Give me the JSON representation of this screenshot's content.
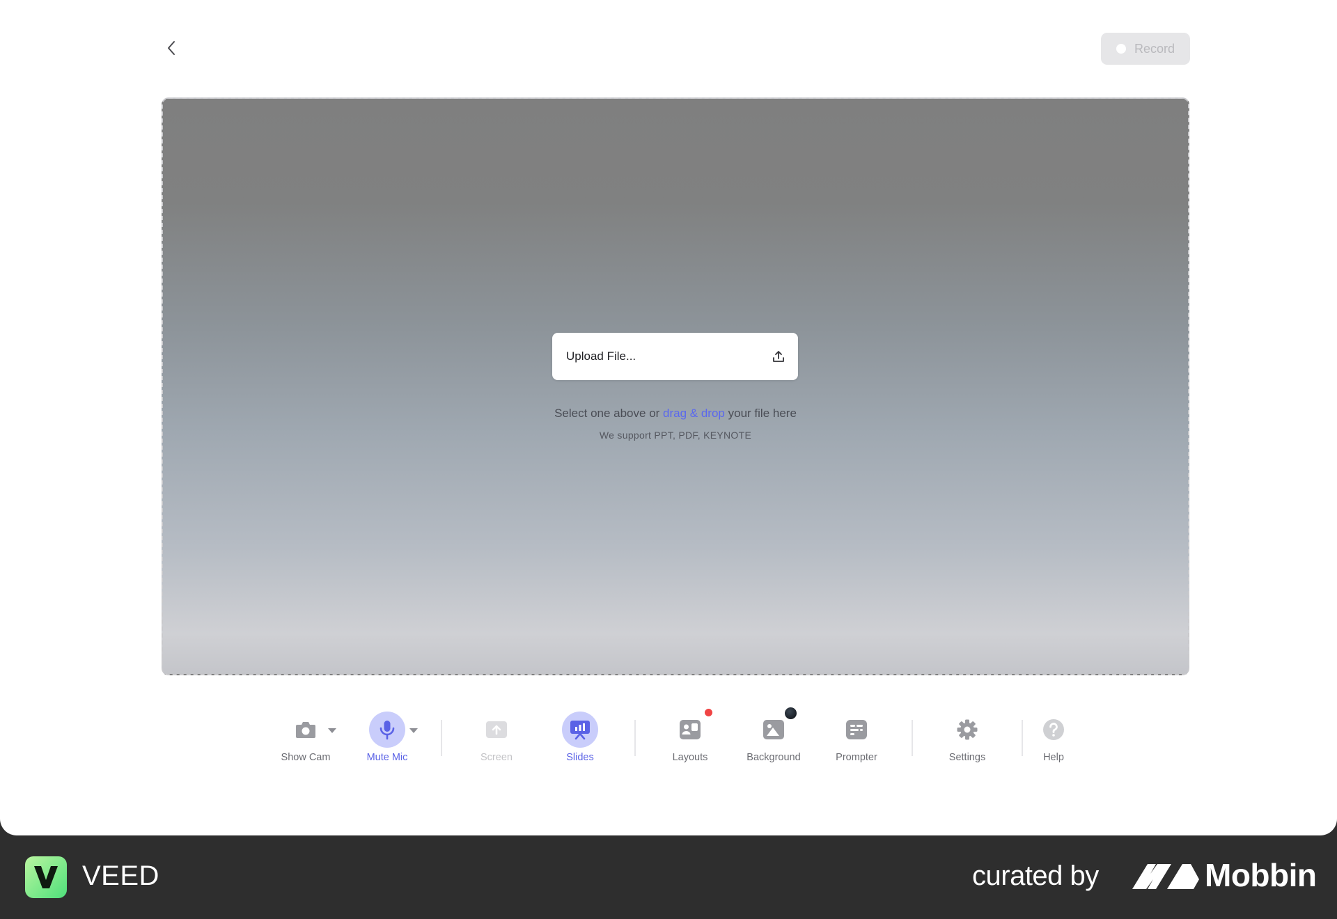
{
  "header": {
    "back_icon": "chevron-left-icon",
    "record_label": "Record"
  },
  "stage": {
    "upload_label": "Upload File...",
    "upload_icon": "upload-icon",
    "hint_prefix": "Select one above or",
    "hint_link": "drag & drop",
    "hint_suffix": "your file here",
    "support_text": "We support PPT, PDF, KEYNOTE"
  },
  "toolbar": {
    "show_cam": {
      "label": "Show Cam",
      "icon": "camera-icon"
    },
    "mute_mic": {
      "label": "Mute Mic",
      "icon": "microphone-icon"
    },
    "screen": {
      "label": "Screen",
      "icon": "screen-share-icon"
    },
    "slides": {
      "label": "Slides",
      "icon": "presentation-icon"
    },
    "layouts": {
      "label": "Layouts",
      "icon": "layouts-icon"
    },
    "background": {
      "label": "Background",
      "icon": "image-icon"
    },
    "prompter": {
      "label": "Prompter",
      "icon": "prompter-icon"
    },
    "settings": {
      "label": "Settings",
      "icon": "gear-icon"
    },
    "help": {
      "label": "Help",
      "icon": "help-icon"
    }
  },
  "footer": {
    "brand": "VEED",
    "curated_by": "curated by",
    "curator": "Mobbin"
  },
  "colors": {
    "accent": "#5a62e6",
    "link": "#5a68ee",
    "active_bg": "#c9cdfb",
    "veed_green": "#4fe07b",
    "badge_red": "#f04444"
  }
}
